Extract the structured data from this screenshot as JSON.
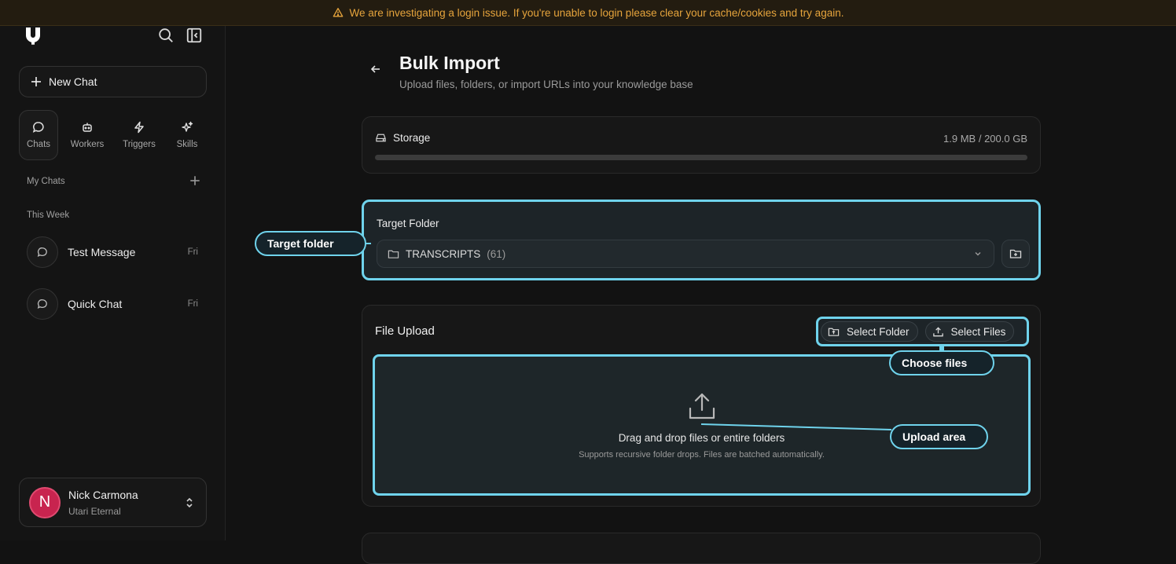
{
  "banner": {
    "icon": "warning-icon",
    "text": "We are investigating a login issue. If you're unable to login please clear your cache/cookies and try again.",
    "color": "#e6a43c"
  },
  "sidebar": {
    "new_chat_label": "New Chat",
    "tabs": [
      {
        "label": "Chats",
        "icon": "chat-bubble-icon",
        "active": true
      },
      {
        "label": "Workers",
        "icon": "robot-icon",
        "active": false
      },
      {
        "label": "Triggers",
        "icon": "lightning-icon",
        "active": false
      },
      {
        "label": "Skills",
        "icon": "sparkles-icon",
        "active": false
      }
    ],
    "my_chats_label": "My Chats",
    "this_week_label": "This Week",
    "chats": [
      {
        "title": "Test Message",
        "day": "Fri"
      },
      {
        "title": "Quick Chat",
        "day": "Fri"
      }
    ],
    "user": {
      "initial": "N",
      "name": "Nick Carmona",
      "org": "Utari Eternal",
      "avatar_color": "#c8244f"
    }
  },
  "page": {
    "title": "Bulk Import",
    "subtitle": "Upload files, folders, or import URLs into your knowledge base"
  },
  "storage": {
    "label": "Storage",
    "usage": "1.9 MB / 200.0 GB",
    "used_fraction": 1e-05
  },
  "target_folder": {
    "label": "Target Folder",
    "selected_name": "TRANSCRIPTS",
    "selected_count": "(61)"
  },
  "file_upload": {
    "title": "File Upload",
    "select_folder_label": "Select Folder",
    "select_files_label": "Select Files",
    "drop_title": "Drag and drop files or entire folders",
    "drop_sub": "Supports recursive folder drops. Files are batched automatically."
  },
  "annotations": {
    "target_folder": "Target folder",
    "choose_files": "Choose files",
    "upload_area": "Upload area",
    "highlight_color": "#6fd3ec"
  }
}
